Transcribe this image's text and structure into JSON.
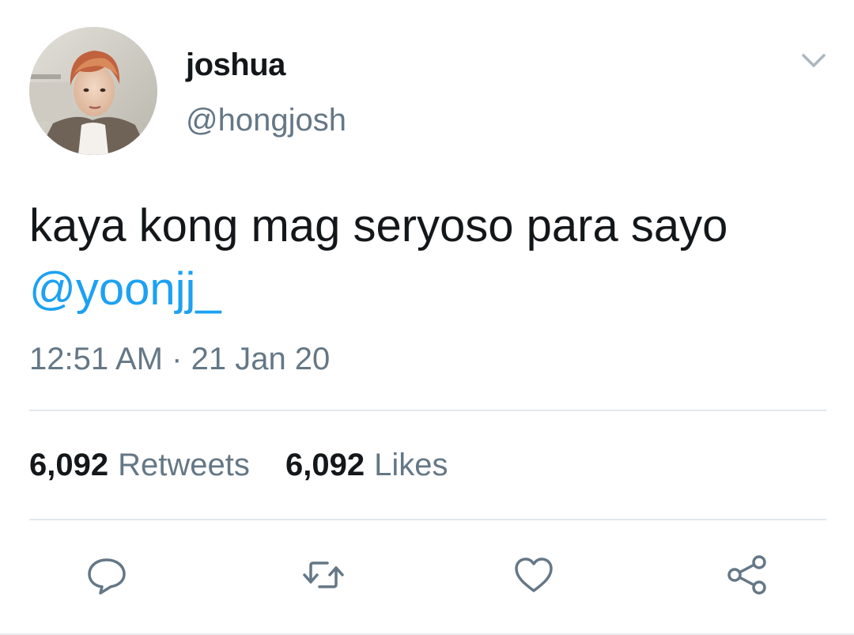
{
  "user": {
    "display_name": "joshua",
    "handle": "@hongjosh"
  },
  "tweet": {
    "text_line1": "kaya kong mag seryoso para sayo",
    "mention": "@yoonjj_",
    "time": "12:51 AM",
    "separator": "·",
    "date": "21 Jan 20"
  },
  "stats": {
    "retweets_count": "6,092",
    "retweets_label": "Retweets",
    "likes_count": "6,092",
    "likes_label": "Likes"
  },
  "icons": {
    "caret": "chevron-down-icon",
    "reply": "reply-icon",
    "retweet": "retweet-icon",
    "like": "heart-icon",
    "share": "share-icon"
  },
  "colors": {
    "text": "#14171a",
    "muted": "#657786",
    "link": "#1da1f2",
    "divider": "#e1e8ed"
  }
}
